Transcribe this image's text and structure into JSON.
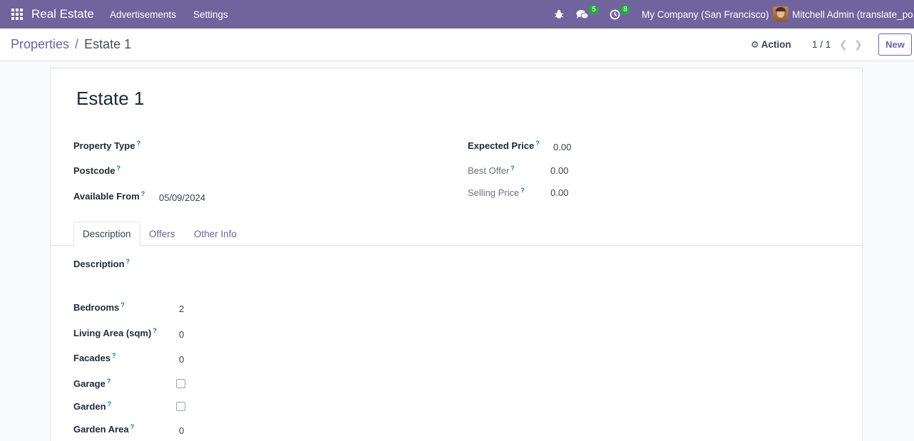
{
  "navbar": {
    "app_name": "Real Estate",
    "menu": [
      "Advertisements",
      "Settings"
    ],
    "messages_count": "5",
    "activities_count": "8",
    "company": "My Company (San Francisco)",
    "user": "Mitchell Admin (translate_po",
    "accent_color": "#71639e",
    "badge_color": "#28a745"
  },
  "breadcrumb": {
    "parent": "Properties",
    "separator": "/",
    "current": "Estate 1"
  },
  "control": {
    "action_label": "Action",
    "pager": "1 / 1",
    "new_label": "New"
  },
  "form": {
    "title": "Estate 1",
    "help_mark": "?",
    "left_fields": [
      {
        "label": "Property Type",
        "value": ""
      },
      {
        "label": "Postcode",
        "value": ""
      },
      {
        "label": "Available From",
        "value": "05/09/2024"
      }
    ],
    "right_fields": [
      {
        "label": "Expected Price",
        "value": "0.00"
      },
      {
        "label": "Best Offer",
        "value": "0.00"
      },
      {
        "label": "Selling Price",
        "value": "0.00"
      }
    ],
    "tabs": [
      "Description",
      "Offers",
      "Other Info"
    ],
    "active_tab": "Description",
    "description_label": "Description",
    "detail_fields": [
      {
        "label": "Bedrooms",
        "value": "2"
      },
      {
        "label": "Living Area (sqm)",
        "value": "0"
      },
      {
        "label": "Facades",
        "value": "0"
      },
      {
        "label": "Garage",
        "value": "",
        "checked": false
      },
      {
        "label": "Garden",
        "value": "",
        "checked": false
      },
      {
        "label": "Garden Area",
        "value": "0"
      }
    ]
  }
}
